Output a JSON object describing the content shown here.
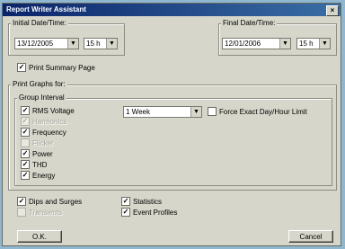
{
  "window": {
    "title": "Report Writer Assistant",
    "close_label": "×"
  },
  "initial": {
    "label": "Initial Date/Time:",
    "date": "13/12/2005",
    "hour": "15 h"
  },
  "final": {
    "label": "Final Date/Time:",
    "date": "12/01/2006",
    "hour": "15 h"
  },
  "summary_page": {
    "label": "Print Summary Page",
    "checked": true
  },
  "graphs": {
    "label": "Print Graphs for:",
    "group_interval_label": "Group Interval",
    "items": [
      {
        "label": "RMS Voltage",
        "checked": true,
        "enabled": true
      },
      {
        "label": "Harmonics",
        "checked": true,
        "enabled": false
      },
      {
        "label": "Frequency",
        "checked": true,
        "enabled": true
      },
      {
        "label": "Flicker",
        "checked": false,
        "enabled": false
      },
      {
        "label": "Power",
        "checked": true,
        "enabled": true
      },
      {
        "label": "THD",
        "checked": true,
        "enabled": true
      },
      {
        "label": "Energy",
        "checked": true,
        "enabled": true
      }
    ],
    "interval_value": "1 Week",
    "force_exact_label": "Force Exact Day/Hour Limit",
    "force_exact_checked": false
  },
  "extras": {
    "dips": {
      "label": "Dips and Surges",
      "checked": true
    },
    "transients": {
      "label": "Transients",
      "checked": false
    },
    "statistics": {
      "label": "Statistics",
      "checked": true
    },
    "event_profiles": {
      "label": "Event Profiles",
      "checked": true
    }
  },
  "buttons": {
    "ok": "O.K.",
    "cancel": "Cancel"
  }
}
